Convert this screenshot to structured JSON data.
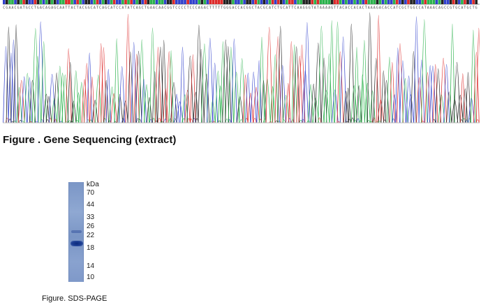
{
  "figure_sequencing": {
    "caption": "Figure . Gene Sequencing (extract)"
  },
  "figure_gel": {
    "unit_label": "kDa",
    "markers": [
      "70",
      "44",
      "33",
      "26",
      "22",
      "18",
      "14",
      "10"
    ],
    "caption": "Figure. SDS-PAGE"
  },
  "colors": {
    "A": "#2bb24c",
    "C": "#3040cc",
    "G": "#222222",
    "T": "#dd2a2a"
  }
}
